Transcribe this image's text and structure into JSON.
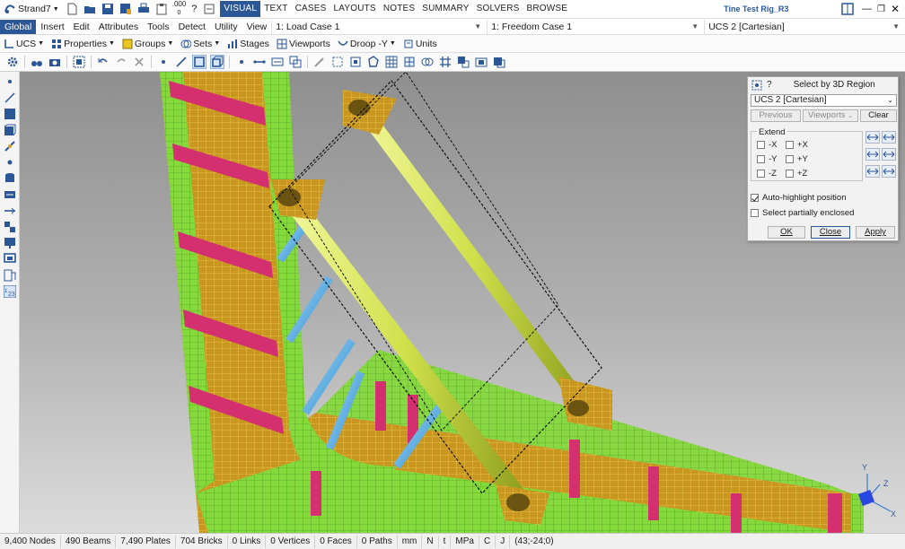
{
  "app": {
    "name": "Strand7",
    "title": "Tine Test Rig_R3"
  },
  "ribbon_tabs": [
    {
      "label": "VISUAL",
      "active": true
    },
    {
      "label": "TEXT"
    },
    {
      "label": "CASES"
    },
    {
      "label": "LAYOUTS"
    },
    {
      "label": "NOTES"
    },
    {
      "label": "SUMMARY"
    },
    {
      "label": "SOLVERS"
    },
    {
      "label": "BROWSE"
    }
  ],
  "qat_number": ".000",
  "menus": [
    "Global",
    "Insert",
    "Edit",
    "Attributes",
    "Tools",
    "Detect",
    "Utility",
    "View"
  ],
  "load_case": "1: Load Case 1",
  "freedom_case": "1: Freedom Case 1",
  "ucs_top": "UCS 2 [Cartesian]",
  "toolbar3": {
    "ucs": "UCS",
    "properties": "Properties",
    "groups": "Groups",
    "sets": "Sets",
    "stages": "Stages",
    "viewports": "Viewports",
    "droop": "Droop -Y",
    "units": "Units"
  },
  "dialog": {
    "title": "Select by 3D Region",
    "ucs": "UCS 2 [Cartesian]",
    "previous": "Previous",
    "viewports": "Viewports",
    "clear": "Clear",
    "extend": "Extend",
    "extend_opts": [
      "-X",
      "+X",
      "-Y",
      "+Y",
      "-Z",
      "+Z"
    ],
    "auto_highlight": "Auto-highlight position",
    "auto_highlight_checked": true,
    "partial": "Select partially enclosed",
    "partial_checked": false,
    "ok": "OK",
    "close": "Close",
    "apply": "Apply"
  },
  "axes": {
    "x": "X",
    "y": "Y",
    "z": "Z"
  },
  "status": [
    "9,400 Nodes",
    "490 Beams",
    "7,490 Plates",
    "704 Bricks",
    "0 Links",
    "0 Vertices",
    "0 Faces",
    "0 Paths",
    "mm",
    "N",
    "t",
    "MPa",
    "C",
    "J",
    "(43;-24;0)"
  ],
  "colors": {
    "accent": "#2b5797",
    "plate_green": "#84d93b",
    "plate_orange": "#c9961f",
    "plate_magenta": "#d4306f",
    "beam_blue": "#42a8e0",
    "brace_yellow": "#dcea5a"
  }
}
